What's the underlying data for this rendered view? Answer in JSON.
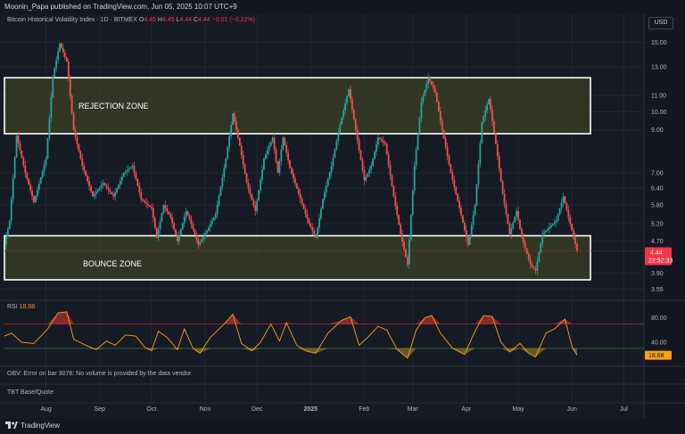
{
  "header": {
    "published": "Moonin_Papa published on TradingView.com, Jun 05, 2025 10:07 UTC+9",
    "currency": "USD"
  },
  "legend": {
    "symbol": "Bitcoin Historical Volatility Index · 1D · BITMEX",
    "o_key": "O",
    "o_val": "4.45",
    "h_key": "H",
    "h_val": "4.45",
    "l_key": "L",
    "l_val": "4.44",
    "c_key": "C",
    "c_val": "4.44",
    "change": "−0.01 (−0.22%)"
  },
  "zones": {
    "rejection_label": "REJECTION ZONE",
    "bounce_label": "BOUNCE ZONE"
  },
  "price_tag": {
    "value": "4.44",
    "countdown": "22:52:33"
  },
  "rsi": {
    "label": "RSI",
    "value": "18.68",
    "tag": "18.68",
    "upper": 70,
    "lower": 30
  },
  "obv_message": "OBV: Error on bar 3076: No volume is provided by the data vendor.",
  "base_quote": "TBT Base/Quote",
  "brand": "TradingView",
  "colors": {
    "up": "#26a69a",
    "down": "#ef5350",
    "rsi": "#f7a21b",
    "zone_fill": "#3b3f24",
    "price_tag": "#f23645"
  },
  "chart_data": {
    "type": "candlestick",
    "title": "Bitcoin Historical Volatility Index · 1D · BITMEX",
    "y_scale": "log",
    "y_ticks": [
      15.0,
      13.0,
      11.0,
      10.0,
      9.0,
      7.0,
      6.4,
      5.8,
      5.2,
      4.7,
      3.9,
      3.55
    ],
    "y_tick_labels": [
      "15.00",
      "13.00",
      "11.00",
      "10.00",
      "9.00",
      "7.00",
      "6.40",
      "5.80",
      "5.20",
      "4.70",
      "3.90",
      "3.55"
    ],
    "x_labels": [
      "Aug",
      "Sep",
      "Oct",
      "Nov",
      "Dec",
      "2025",
      "Feb",
      "Mar",
      "Apr",
      "May",
      "Jun",
      "Jul"
    ],
    "zones": [
      {
        "name": "REJECTION ZONE",
        "low": 8.8,
        "high": 12.2
      },
      {
        "name": "BOUNCE ZONE",
        "low": 3.75,
        "high": 4.85
      }
    ],
    "close_path": [
      [
        "2024-07-08",
        4.6
      ],
      [
        "2024-07-11",
        5.3
      ],
      [
        "2024-07-15",
        8.7
      ],
      [
        "2024-07-20",
        7.0
      ],
      [
        "2024-07-25",
        5.9
      ],
      [
        "2024-08-01",
        7.6
      ],
      [
        "2024-08-05",
        12.3
      ],
      [
        "2024-08-09",
        14.9
      ],
      [
        "2024-08-13",
        13.4
      ],
      [
        "2024-08-17",
        9.0
      ],
      [
        "2024-08-22",
        7.3
      ],
      [
        "2024-08-28",
        6.1
      ],
      [
        "2024-09-03",
        6.6
      ],
      [
        "2024-09-09",
        6.1
      ],
      [
        "2024-09-15",
        7.0
      ],
      [
        "2024-09-20",
        7.3
      ],
      [
        "2024-09-25",
        6.0
      ],
      [
        "2024-10-01",
        5.7
      ],
      [
        "2024-10-04",
        4.8
      ],
      [
        "2024-10-08",
        5.8
      ],
      [
        "2024-10-12",
        5.4
      ],
      [
        "2024-10-16",
        4.7
      ],
      [
        "2024-10-21",
        5.6
      ],
      [
        "2024-10-24",
        5.2
      ],
      [
        "2024-10-28",
        4.6
      ],
      [
        "2024-11-02",
        5.0
      ],
      [
        "2024-11-07",
        5.5
      ],
      [
        "2024-11-13",
        7.6
      ],
      [
        "2024-11-17",
        9.9
      ],
      [
        "2024-11-21",
        8.2
      ],
      [
        "2024-11-25",
        6.6
      ],
      [
        "2024-11-30",
        5.6
      ],
      [
        "2024-12-05",
        7.6
      ],
      [
        "2024-12-10",
        8.6
      ],
      [
        "2024-12-13",
        7.0
      ],
      [
        "2024-12-16",
        8.6
      ],
      [
        "2024-12-20",
        7.2
      ],
      [
        "2024-12-25",
        6.2
      ],
      [
        "2024-12-31",
        5.2
      ],
      [
        "2025-01-04",
        4.8
      ],
      [
        "2025-01-08",
        6.0
      ],
      [
        "2025-01-13",
        7.3
      ],
      [
        "2025-01-18",
        9.3
      ],
      [
        "2025-01-23",
        11.4
      ],
      [
        "2025-01-28",
        8.5
      ],
      [
        "2025-02-01",
        6.7
      ],
      [
        "2025-02-05",
        7.3
      ],
      [
        "2025-02-09",
        8.6
      ],
      [
        "2025-02-13",
        8.3
      ],
      [
        "2025-02-18",
        6.1
      ],
      [
        "2025-02-22",
        4.9
      ],
      [
        "2025-02-26",
        4.1
      ],
      [
        "2025-03-02",
        7.3
      ],
      [
        "2025-03-06",
        10.6
      ],
      [
        "2025-03-10",
        12.2
      ],
      [
        "2025-03-14",
        11.2
      ],
      [
        "2025-03-18",
        9.0
      ],
      [
        "2025-03-23",
        7.0
      ],
      [
        "2025-03-28",
        5.7
      ],
      [
        "2025-04-02",
        4.6
      ],
      [
        "2025-04-06",
        5.8
      ],
      [
        "2025-04-10",
        9.4
      ],
      [
        "2025-04-14",
        10.8
      ],
      [
        "2025-04-18",
        8.3
      ],
      [
        "2025-04-22",
        6.2
      ],
      [
        "2025-04-26",
        4.9
      ],
      [
        "2025-04-30",
        5.6
      ],
      [
        "2025-05-03",
        4.8
      ],
      [
        "2025-05-08",
        4.1
      ],
      [
        "2025-05-11",
        3.95
      ],
      [
        "2025-05-15",
        4.9
      ],
      [
        "2025-05-19",
        5.1
      ],
      [
        "2025-05-23",
        5.3
      ],
      [
        "2025-05-27",
        6.1
      ],
      [
        "2025-05-31",
        5.2
      ],
      [
        "2025-06-04",
        4.44
      ]
    ],
    "rsi_path": [
      [
        "2024-07-08",
        50
      ],
      [
        "2024-07-12",
        55
      ],
      [
        "2024-07-18",
        40
      ],
      [
        "2024-07-25",
        38
      ],
      [
        "2024-08-02",
        62
      ],
      [
        "2024-08-08",
        88
      ],
      [
        "2024-08-13",
        90
      ],
      [
        "2024-08-17",
        45
      ],
      [
        "2024-08-24",
        35
      ],
      [
        "2024-08-30",
        28
      ],
      [
        "2024-09-05",
        42
      ],
      [
        "2024-09-10",
        35
      ],
      [
        "2024-09-16",
        52
      ],
      [
        "2024-09-22",
        50
      ],
      [
        "2024-09-27",
        32
      ],
      [
        "2024-10-01",
        26
      ],
      [
        "2024-10-05",
        58
      ],
      [
        "2024-10-10",
        48
      ],
      [
        "2024-10-16",
        28
      ],
      [
        "2024-10-20",
        62
      ],
      [
        "2024-10-25",
        30
      ],
      [
        "2024-10-29",
        22
      ],
      [
        "2024-11-04",
        48
      ],
      [
        "2024-11-12",
        70
      ],
      [
        "2024-11-17",
        86
      ],
      [
        "2024-11-22",
        38
      ],
      [
        "2024-11-28",
        26
      ],
      [
        "2024-12-03",
        40
      ],
      [
        "2024-12-09",
        70
      ],
      [
        "2024-12-14",
        42
      ],
      [
        "2024-12-18",
        72
      ],
      [
        "2024-12-24",
        35
      ],
      [
        "2024-12-30",
        25
      ],
      [
        "2025-01-04",
        22
      ],
      [
        "2025-01-11",
        55
      ],
      [
        "2025-01-19",
        76
      ],
      [
        "2025-01-24",
        82
      ],
      [
        "2025-01-29",
        35
      ],
      [
        "2025-02-03",
        48
      ],
      [
        "2025-02-09",
        66
      ],
      [
        "2025-02-14",
        60
      ],
      [
        "2025-02-20",
        28
      ],
      [
        "2025-02-26",
        14
      ],
      [
        "2025-03-03",
        60
      ],
      [
        "2025-03-08",
        80
      ],
      [
        "2025-03-12",
        84
      ],
      [
        "2025-03-17",
        55
      ],
      [
        "2025-03-24",
        30
      ],
      [
        "2025-03-31",
        20
      ],
      [
        "2025-04-06",
        58
      ],
      [
        "2025-04-11",
        84
      ],
      [
        "2025-04-16",
        82
      ],
      [
        "2025-04-21",
        40
      ],
      [
        "2025-04-26",
        24
      ],
      [
        "2025-05-02",
        38
      ],
      [
        "2025-05-07",
        22
      ],
      [
        "2025-05-11",
        16
      ],
      [
        "2025-05-17",
        55
      ],
      [
        "2025-05-22",
        62
      ],
      [
        "2025-05-28",
        78
      ],
      [
        "2025-06-01",
        34
      ],
      [
        "2025-06-04",
        18.68
      ]
    ]
  }
}
